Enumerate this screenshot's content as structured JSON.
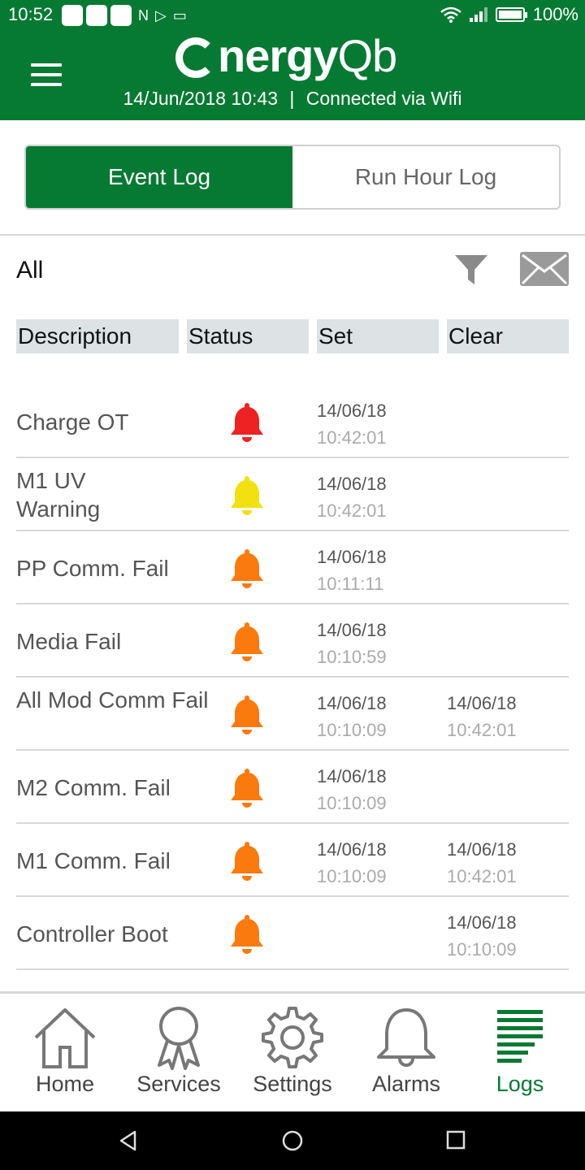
{
  "status_bar": {
    "time": "10:52",
    "battery": "100%"
  },
  "header": {
    "logo_main": "nergy",
    "logo_suffix": "Qb",
    "date_time": "14/Jun/2018 10:43",
    "separator": "|",
    "connection": "Connected via Wifi"
  },
  "tabs": [
    {
      "label": "Event Log",
      "active": true
    },
    {
      "label": "Run Hour Log",
      "active": false
    }
  ],
  "filter": {
    "label": "All"
  },
  "columns": [
    "Description",
    "Status",
    "Set",
    "Clear"
  ],
  "rows": [
    {
      "description": "Charge OT",
      "status_color": "#ee2222",
      "set_date": "14/06/18",
      "set_time": "10:42:01",
      "clear_date": "",
      "clear_time": ""
    },
    {
      "description": "M1 UV Warning",
      "status_color": "#f2e011",
      "set_date": "14/06/18",
      "set_time": "10:42:01",
      "clear_date": "",
      "clear_time": ""
    },
    {
      "description": "PP Comm. Fail",
      "status_color": "#fb7a0e",
      "set_date": "14/06/18",
      "set_time": "10:11:11",
      "clear_date": "",
      "clear_time": ""
    },
    {
      "description": "Media Fail",
      "status_color": "#fb7a0e",
      "set_date": "14/06/18",
      "set_time": "10:10:59",
      "clear_date": "",
      "clear_time": ""
    },
    {
      "description": "All Mod Comm Fail",
      "status_color": "#fb7a0e",
      "set_date": "14/06/18",
      "set_time": "10:10:09",
      "clear_date": "14/06/18",
      "clear_time": "10:42:01"
    },
    {
      "description": "M2 Comm. Fail",
      "status_color": "#fb7a0e",
      "set_date": "14/06/18",
      "set_time": "10:10:09",
      "clear_date": "",
      "clear_time": ""
    },
    {
      "description": "M1 Comm. Fail",
      "status_color": "#fb7a0e",
      "set_date": "14/06/18",
      "set_time": "10:10:09",
      "clear_date": "14/06/18",
      "clear_time": "10:42:01"
    },
    {
      "description": "Controller Boot",
      "status_color": "#fb7a0e",
      "set_date": "",
      "set_time": "",
      "clear_date": "14/06/18",
      "clear_time": "10:10:09"
    }
  ],
  "nav": [
    {
      "label": "Home",
      "icon": "home-icon",
      "active": false
    },
    {
      "label": "Services",
      "icon": "ribbon-icon",
      "active": false
    },
    {
      "label": "Settings",
      "icon": "gear-icon",
      "active": false
    },
    {
      "label": "Alarms",
      "icon": "bell-icon",
      "active": false
    },
    {
      "label": "Logs",
      "icon": "logs-icon",
      "active": true
    }
  ],
  "colors": {
    "brand_green": "#067a32",
    "alarm_red": "#ee2222",
    "alarm_yellow": "#f2e011",
    "alarm_orange": "#fb7a0e"
  }
}
